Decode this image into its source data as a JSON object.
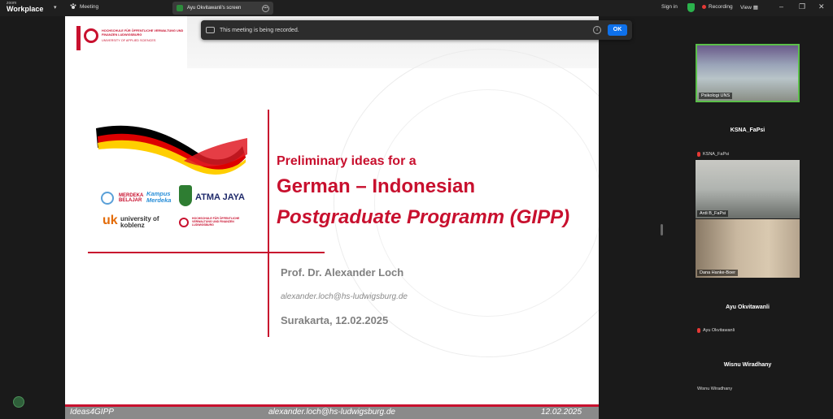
{
  "app": {
    "brand_small": "zoom",
    "brand_big": "Workplace"
  },
  "toolbar": {
    "meeting_label": "Meeting",
    "share_label": "Ayu Okvitawanli's screen",
    "signin_label": "Sign in",
    "recording_label": "Recording",
    "view_label": "View"
  },
  "banner": {
    "message": "This meeting is being recorded.",
    "ok_label": "OK"
  },
  "slide": {
    "university_name": "HOCHSCHULE FÜR ÖFFENTLICHE VERWALTUNG UND FINANZEN LUDWIGSBURG",
    "university_sub": "UNIVERSITY OF APPLIED SCIENCES",
    "partner_1": "MERDEKA BELAJAR",
    "partner_2": "Kampus Merdeka",
    "partner_3": "ATMA JAYA",
    "partner_4": "university of koblenz",
    "pre_title": "Preliminary ideas for a",
    "main_title": "German – Indonesian",
    "sub_title": "Postgraduate Programm (GIPP)",
    "author": "Prof. Dr. Alexander Loch",
    "email": "alexander.loch@hs-ludwigsburg.de",
    "place_date": "Surakarta,  12.02.2025",
    "footer_left": "Ideas4GIPP",
    "footer_center": "alexander.loch@hs-ludwigsburg.de",
    "footer_right": "12.02.2025"
  },
  "participants": [
    {
      "tile_name": "Psikologi UNS"
    },
    {
      "center_name": "KSNA_FaPsi",
      "tag": "KSNA_FaPsi"
    },
    {
      "tile_name": "Ardi B_FaPsi"
    },
    {
      "tile_name": "Dana Hanke-Boer"
    },
    {
      "center_name": "Ayu Okvitawanli",
      "tag": "Ayu Okvitawanli"
    },
    {
      "center_name": "Wisnu Wiradhany",
      "tag": "Wisnu Wiradhany"
    }
  ],
  "colors": {
    "accent_red": "#c8102e",
    "active_green": "#5bbf4a",
    "ok_blue": "#0e71eb"
  }
}
